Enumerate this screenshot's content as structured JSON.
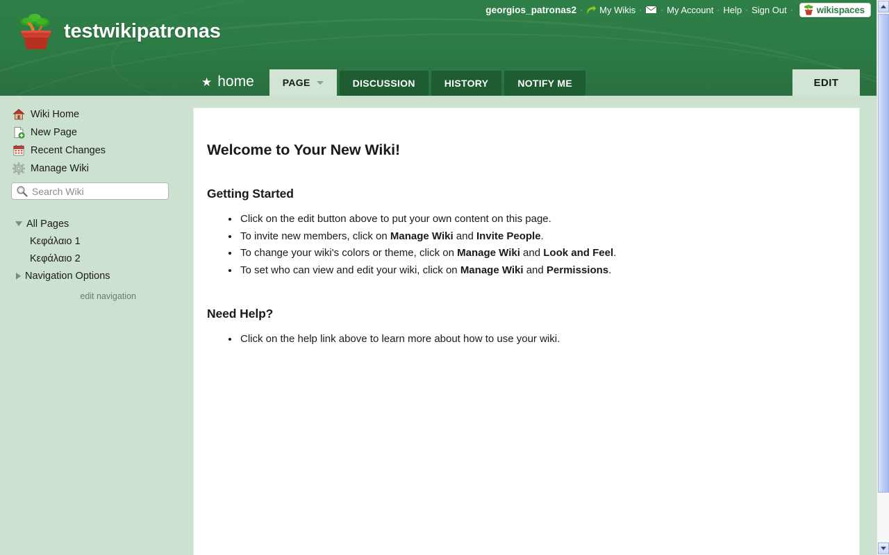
{
  "topbar": {
    "username": "georgios_patronas2",
    "separator": "·",
    "my_wikis": "My Wikis",
    "messages_icon": "envelope-icon",
    "my_account": "My Account",
    "help": "Help",
    "sign_out": "Sign Out",
    "logo_text": "wikispaces",
    "logo_icon": "plant-pot-icon",
    "arrow_icon": "curved-arrow-icon"
  },
  "header": {
    "wiki_title": "testwikipatronas",
    "wiki_icon": "plant-pot-icon",
    "background_color": "#2e7d46"
  },
  "tabs": {
    "home": {
      "label": "home",
      "icon": "star-icon"
    },
    "items": [
      {
        "label": "PAGE",
        "active": true,
        "has_caret": true
      },
      {
        "label": "DISCUSSION",
        "active": false,
        "has_caret": false
      },
      {
        "label": "HISTORY",
        "active": false,
        "has_caret": false
      },
      {
        "label": "NOTIFY ME",
        "active": false,
        "has_caret": false
      }
    ],
    "edit": "EDIT"
  },
  "sidebar": {
    "links": [
      {
        "label": "Wiki Home",
        "icon": "home-icon"
      },
      {
        "label": "New Page",
        "icon": "new-page-icon"
      },
      {
        "label": "Recent Changes",
        "icon": "calendar-icon"
      },
      {
        "label": "Manage Wiki",
        "icon": "gear-icon"
      }
    ],
    "search": {
      "placeholder": "Search Wiki",
      "value": "",
      "icon": "search-icon"
    },
    "tree": [
      {
        "label": "All Pages",
        "expanded": true,
        "child": false
      },
      {
        "label": "Κεφάλαιο 1",
        "expanded": null,
        "child": true
      },
      {
        "label": "Κεφάλαιο 2",
        "expanded": null,
        "child": true
      },
      {
        "label": "Navigation Options",
        "expanded": false,
        "child": false
      }
    ],
    "edit_navigation": "edit navigation",
    "background_color": "#cde1d1"
  },
  "content": {
    "title": "Welcome to Your New Wiki!",
    "section1": {
      "heading": "Getting Started",
      "items": [
        {
          "parts": [
            {
              "t": "Click on the edit button above to put your own content on this page.",
              "b": false
            }
          ]
        },
        {
          "parts": [
            {
              "t": "To invite new members, click on ",
              "b": false
            },
            {
              "t": "Manage Wiki",
              "b": true
            },
            {
              "t": " and ",
              "b": false
            },
            {
              "t": "Invite People",
              "b": true
            },
            {
              "t": ".",
              "b": false
            }
          ]
        },
        {
          "parts": [
            {
              "t": "To change your wiki's colors or theme, click on ",
              "b": false
            },
            {
              "t": "Manage Wiki",
              "b": true
            },
            {
              "t": " and ",
              "b": false
            },
            {
              "t": "Look and Feel",
              "b": true
            },
            {
              "t": ".",
              "b": false
            }
          ]
        },
        {
          "parts": [
            {
              "t": "To set who can view and edit your wiki, click on ",
              "b": false
            },
            {
              "t": "Manage Wiki",
              "b": true
            },
            {
              "t": " and ",
              "b": false
            },
            {
              "t": "Permissions",
              "b": true
            },
            {
              "t": ".",
              "b": false
            }
          ]
        }
      ]
    },
    "section2": {
      "heading": "Need Help?",
      "items": [
        {
          "parts": [
            {
              "t": "Click on the help link above to learn more about how to use your wiki.",
              "b": false
            }
          ]
        }
      ]
    }
  },
  "scrollbar": {
    "up_icon": "chevron-up-icon",
    "down_icon": "chevron-down-icon"
  }
}
